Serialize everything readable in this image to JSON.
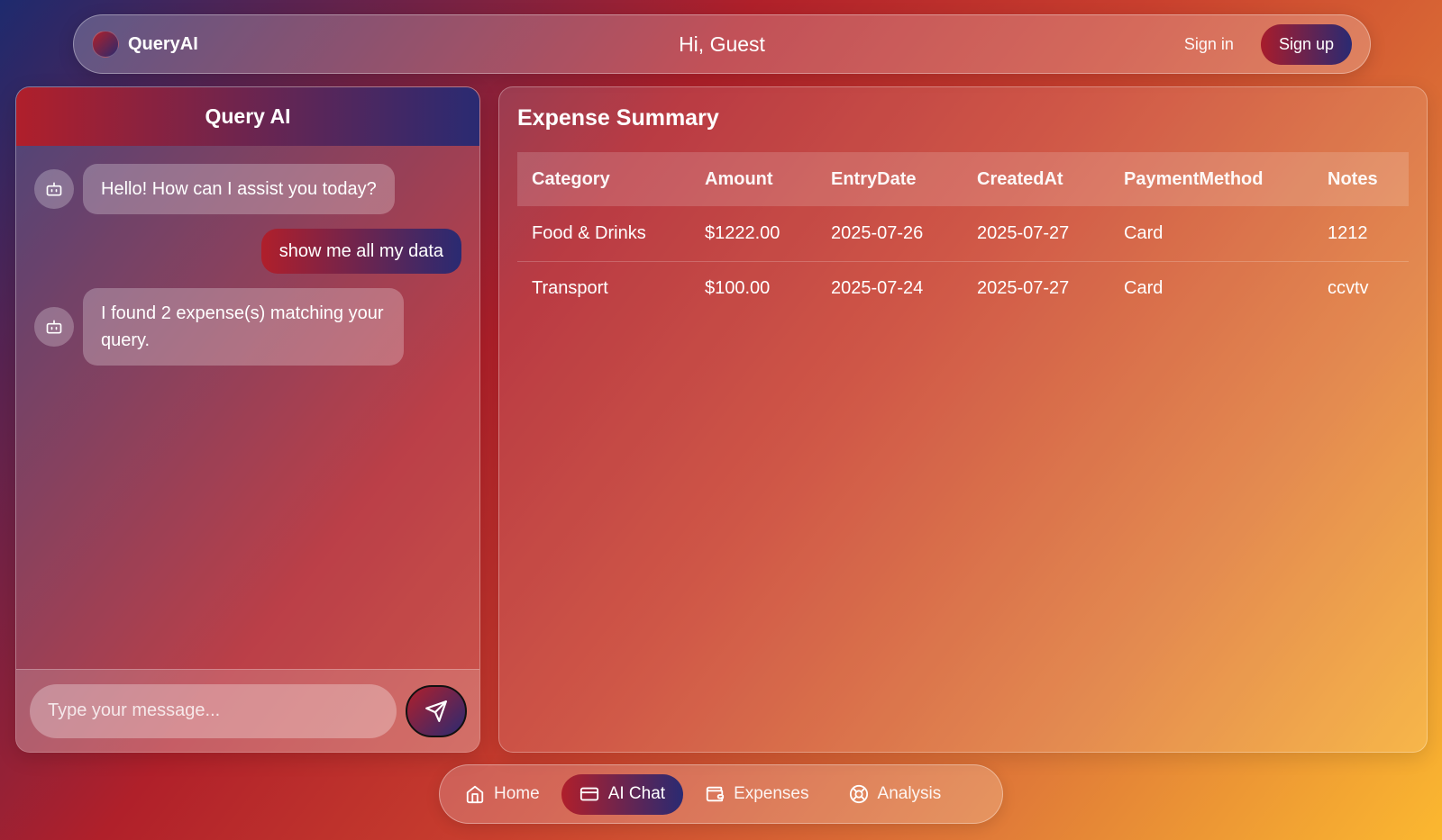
{
  "header": {
    "brand": "QueryAI",
    "greeting": "Hi, Guest",
    "signin": "Sign in",
    "signup": "Sign up"
  },
  "chat": {
    "title": "Query AI",
    "messages": [
      {
        "role": "bot",
        "text": "Hello! How can I assist you today?"
      },
      {
        "role": "user",
        "text": "show me all my data"
      },
      {
        "role": "bot",
        "text": "I found 2 expense(s) matching your query."
      }
    ],
    "input_placeholder": "Type your message..."
  },
  "expense": {
    "title": "Expense Summary",
    "columns": [
      "Category",
      "Amount",
      "EntryDate",
      "CreatedAt",
      "PaymentMethod",
      "Notes"
    ],
    "rows": [
      [
        "Food & Drinks",
        "$1222.00",
        "2025-07-26",
        "2025-07-27",
        "Card",
        "1212"
      ],
      [
        "Transport",
        "$100.00",
        "2025-07-24",
        "2025-07-27",
        "Card",
        "ccvtv"
      ]
    ]
  },
  "nav": {
    "items": [
      {
        "label": "Home",
        "icon": "home-icon"
      },
      {
        "label": "AI Chat",
        "icon": "credit-card-icon",
        "active": true
      },
      {
        "label": "Expenses",
        "icon": "wallet-icon"
      },
      {
        "label": "Analysis",
        "icon": "lifebuoy-icon"
      }
    ]
  },
  "colors": {
    "accent_start": "#b01f2b",
    "accent_end": "#2a2a72"
  }
}
